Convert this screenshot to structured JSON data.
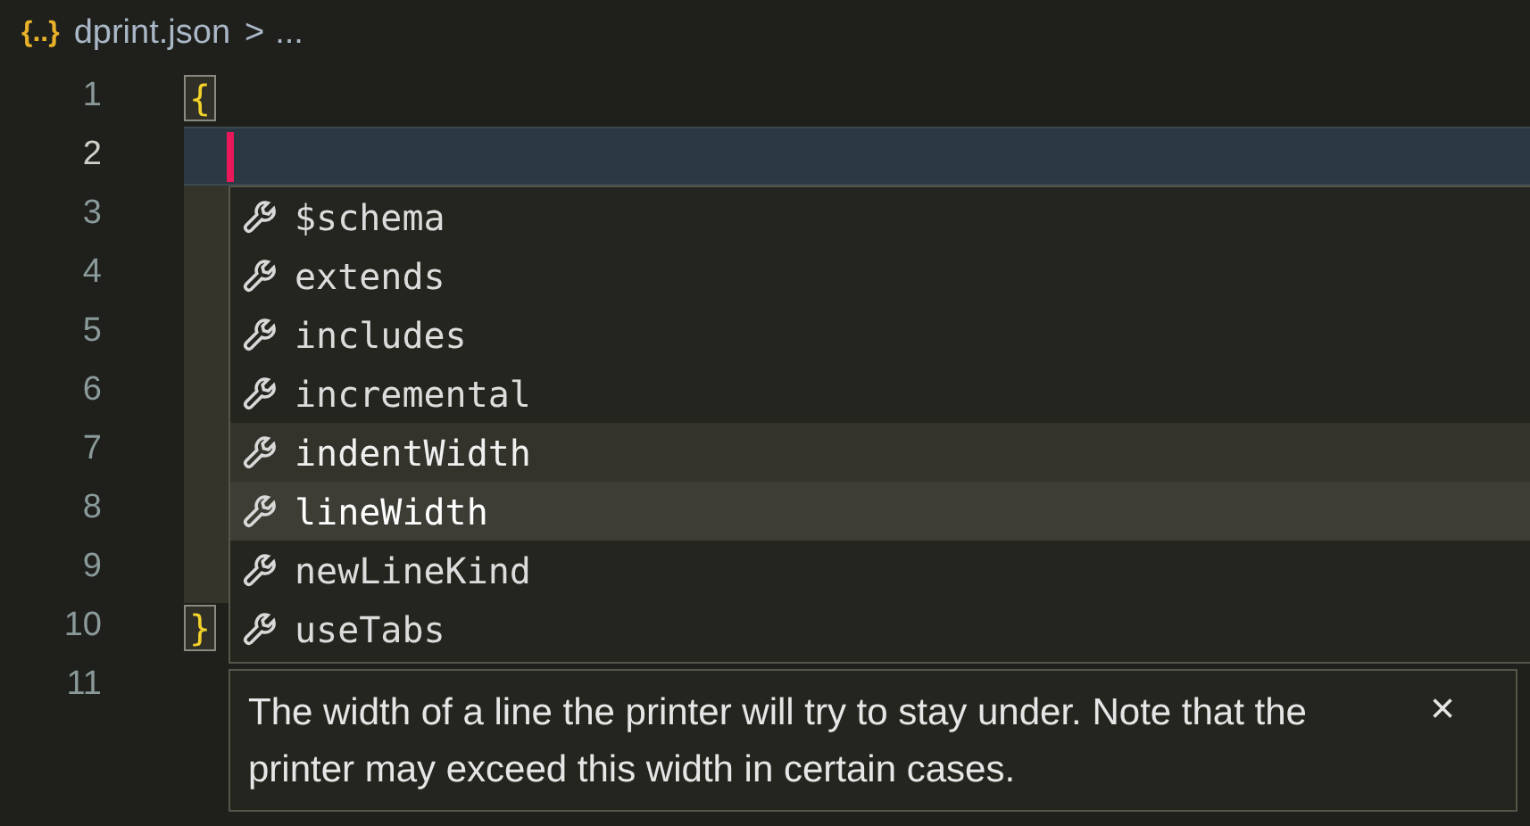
{
  "breadcrumb": {
    "file_icon": "{..}",
    "file": "dprint.json",
    "separator": ">",
    "more": "..."
  },
  "lines": [
    {
      "number": "1",
      "text": "{",
      "bracket_match": true,
      "current": false
    },
    {
      "number": "2",
      "current": true
    },
    {
      "number": "3",
      "current": false
    },
    {
      "number": "4",
      "current": false
    },
    {
      "number": "5",
      "current": false
    },
    {
      "number": "6",
      "current": false
    },
    {
      "number": "7",
      "current": false
    },
    {
      "number": "8",
      "current": false
    },
    {
      "number": "9",
      "current": false
    },
    {
      "number": "10",
      "text": "}",
      "bracket_match": true,
      "current": false
    },
    {
      "number": "11",
      "current": false
    }
  ],
  "suggestions": [
    {
      "label": "$schema",
      "selected": false,
      "hovered": false
    },
    {
      "label": "extends",
      "selected": false,
      "hovered": false
    },
    {
      "label": "includes",
      "selected": false,
      "hovered": false
    },
    {
      "label": "incremental",
      "selected": false,
      "hovered": false
    },
    {
      "label": "indentWidth",
      "selected": false,
      "hovered": true
    },
    {
      "label": "lineWidth",
      "selected": true,
      "hovered": false
    },
    {
      "label": "newLineKind",
      "selected": false,
      "hovered": false
    },
    {
      "label": "useTabs",
      "selected": false,
      "hovered": false
    }
  ],
  "details": {
    "text": "The width of a line the printer will try to stay under. Note that the printer may exceed this width in certain cases.",
    "close": "×"
  }
}
